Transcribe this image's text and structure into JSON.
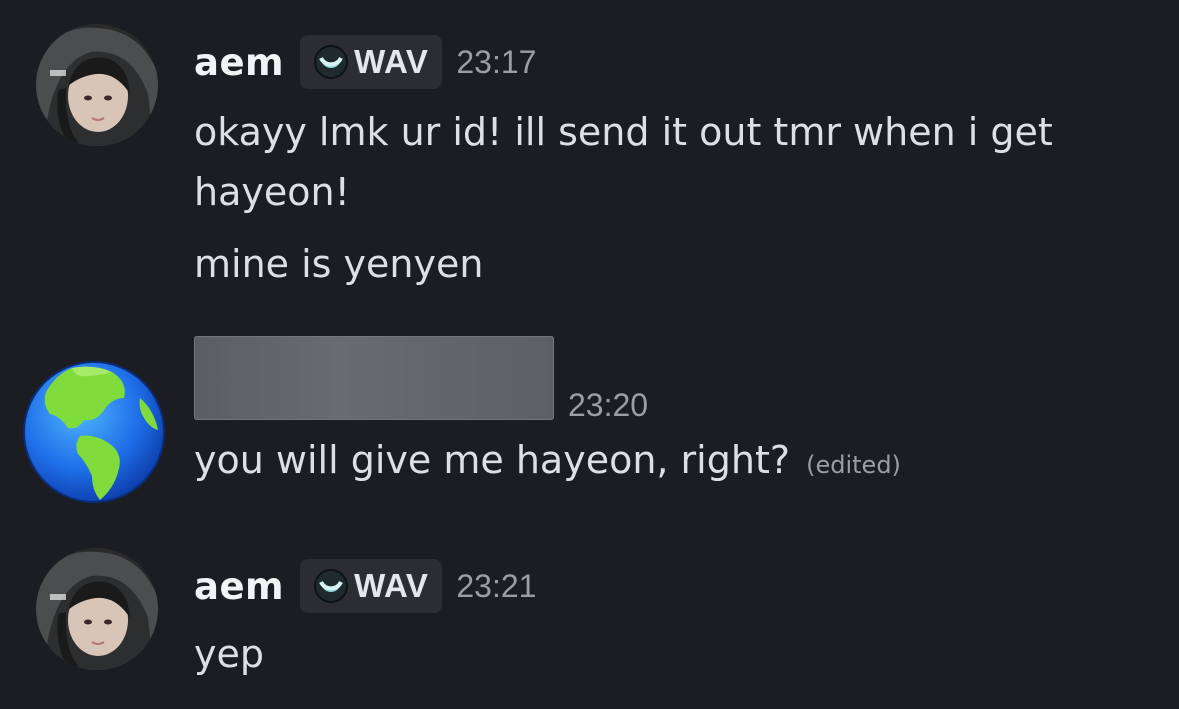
{
  "messages": [
    {
      "author": "aem",
      "tag": "WAV",
      "time": "23:17",
      "lines": [
        "okayy lmk ur id! ill send it out tmr when i get hayeon!",
        "mine is yenyen"
      ],
      "avatar": "user-photo-avatar"
    },
    {
      "author": "",
      "time": "23:20",
      "lines": [
        "you will give me hayeon, right?"
      ],
      "edited_label": "(edited)",
      "avatar": "earth-globe-avatar"
    },
    {
      "author": "aem",
      "tag": "WAV",
      "time": "23:21",
      "lines": [
        "yep"
      ],
      "avatar": "user-photo-avatar"
    }
  ],
  "colors": {
    "background": "#1c1d22",
    "tag_background": "#2c2d33",
    "timestamp": "#9a9ca6",
    "text": "#dedfe3"
  }
}
